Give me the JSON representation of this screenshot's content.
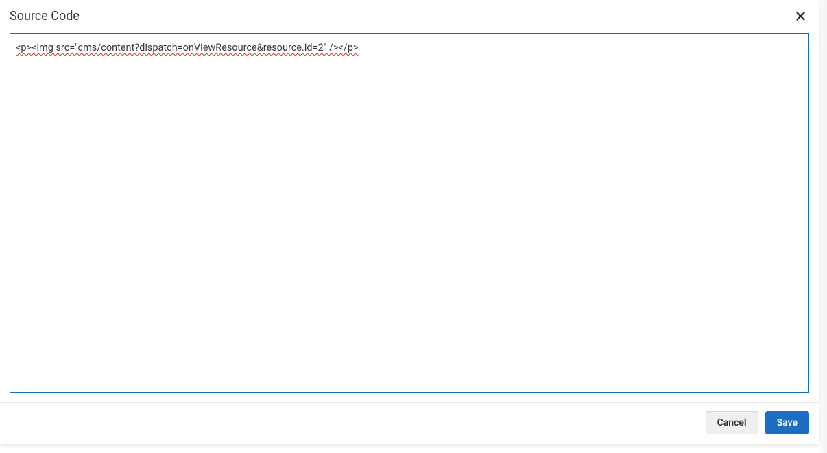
{
  "dialog": {
    "title": "Source Code",
    "source_value": "<p><img src=\"cms/content?dispatch=onViewResource&resource.id=2\" /></p>",
    "cancel_label": "Cancel",
    "save_label": "Save"
  }
}
